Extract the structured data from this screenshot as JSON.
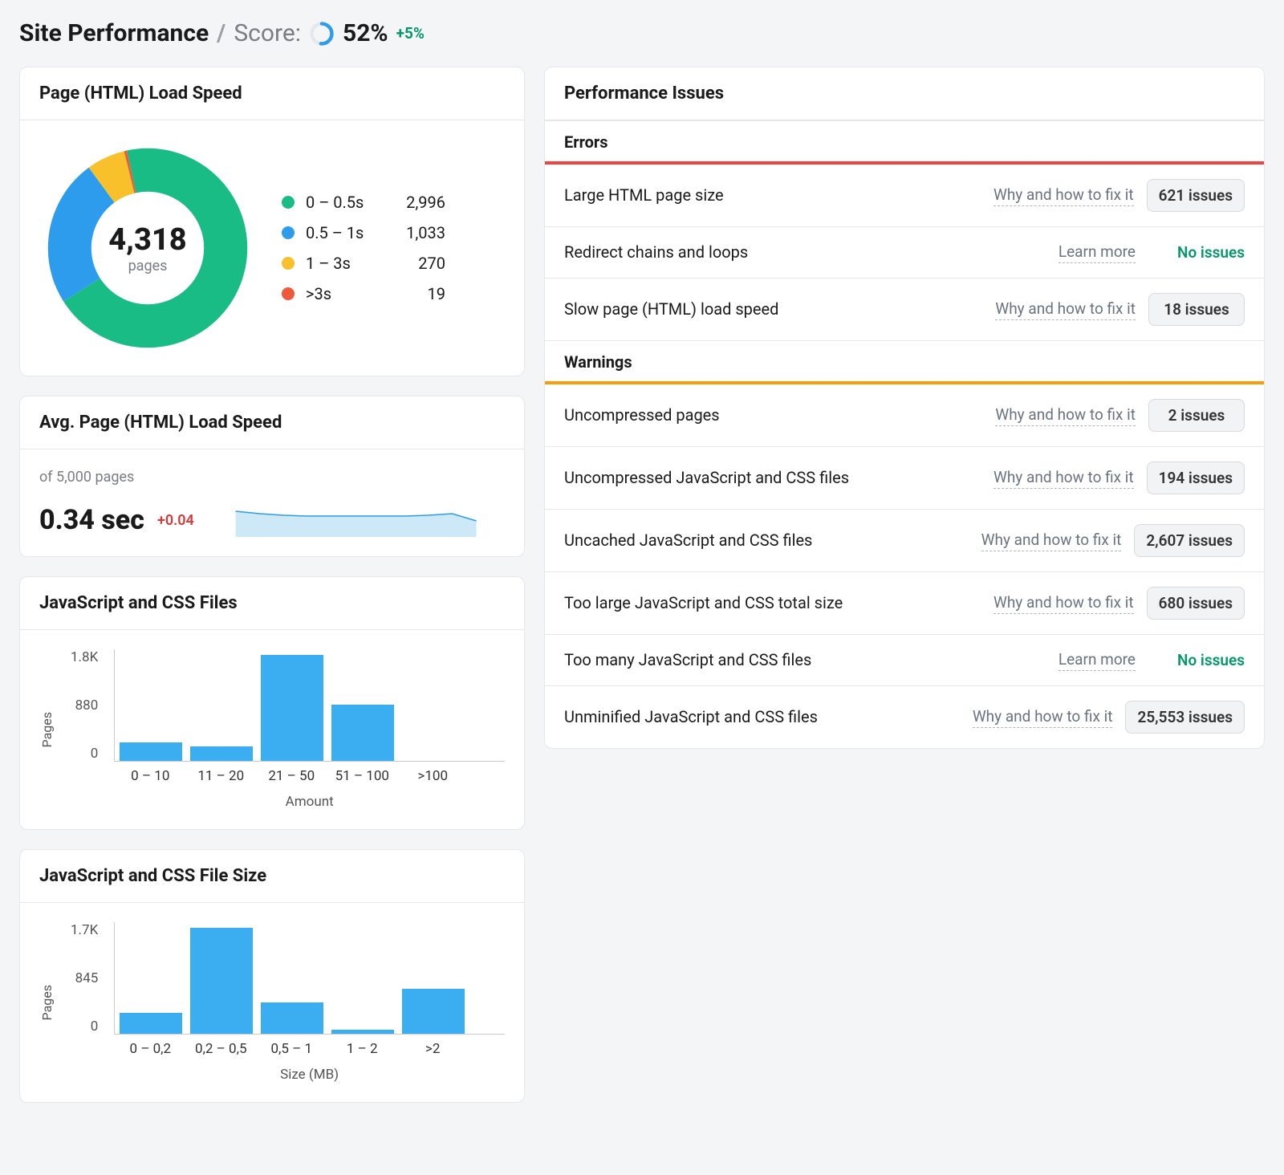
{
  "header": {
    "title": "Site Performance",
    "score_label": "Score:",
    "score_value": "52%",
    "score_delta": "+5%",
    "score_ring_pct": 52
  },
  "loadSpeed": {
    "title": "Page (HTML) Load Speed",
    "total_value": "4,318",
    "total_label": "pages",
    "legend": [
      {
        "label": "0 – 0.5s",
        "value": "2,996",
        "color": "#1abc85"
      },
      {
        "label": "0.5 – 1s",
        "value": "1,033",
        "color": "#2d9ced"
      },
      {
        "label": "1 – 3s",
        "value": "270",
        "color": "#f8c12b"
      },
      {
        "label": ">3s",
        "value": "19",
        "color": "#ed5b3a"
      }
    ]
  },
  "avgSpeed": {
    "title": "Avg. Page (HTML) Load Speed",
    "subtitle": "of 5,000 pages",
    "value": "0.34 sec",
    "delta": "+0.04"
  },
  "jsCssFiles": {
    "title": "JavaScript and CSS Files",
    "ylabel": "Pages",
    "xlabel": "Amount",
    "yticks": [
      "1.8K",
      "880",
      "0"
    ]
  },
  "jsCssSize": {
    "title": "JavaScript and CSS File Size",
    "ylabel": "Pages",
    "xlabel": "Size (MB)",
    "yticks": [
      "1.7K",
      "845",
      "0"
    ]
  },
  "issues": {
    "title": "Performance Issues",
    "errors_label": "Errors",
    "warnings_label": "Warnings",
    "fix_link": "Why and how to fix it",
    "learn_link": "Learn more",
    "no_issues": "No issues",
    "errors": [
      {
        "name": "Large HTML page size",
        "link": "fix",
        "count": "621 issues"
      },
      {
        "name": "Redirect chains and loops",
        "link": "learn",
        "count": null
      },
      {
        "name": "Slow page (HTML) load speed",
        "link": "fix",
        "count": "18 issues"
      }
    ],
    "warnings": [
      {
        "name": "Uncompressed pages",
        "link": "fix",
        "count": "2 issues"
      },
      {
        "name": "Uncompressed JavaScript and CSS files",
        "link": "fix",
        "count": "194 issues"
      },
      {
        "name": "Uncached JavaScript and CSS files",
        "link": "fix",
        "count": "2,607 issues"
      },
      {
        "name": "Too large JavaScript and CSS total size",
        "link": "fix",
        "count": "680 issues"
      },
      {
        "name": "Too many JavaScript and CSS files",
        "link": "learn",
        "count": null
      },
      {
        "name": "Unminified JavaScript and CSS files",
        "link": "fix",
        "count": "25,553 issues"
      }
    ]
  },
  "chart_data": [
    {
      "type": "pie",
      "title": "Page (HTML) Load Speed",
      "categories": [
        "0 – 0.5s",
        "0.5 – 1s",
        "1 – 3s",
        ">3s"
      ],
      "values": [
        2996,
        1033,
        270,
        19
      ],
      "total": 4318
    },
    {
      "type": "bar",
      "title": "JavaScript and CSS Files",
      "xlabel": "Amount",
      "ylabel": "Pages",
      "categories": [
        "0 – 10",
        "11 – 20",
        "21 – 50",
        "51 – 100",
        ">100"
      ],
      "values": [
        320,
        250,
        1800,
        950,
        0
      ],
      "ylim": [
        0,
        1800
      ]
    },
    {
      "type": "bar",
      "title": "JavaScript and CSS File Size",
      "xlabel": "Size (MB)",
      "ylabel": "Pages",
      "categories": [
        "0 – 0,2",
        "0,2 – 0,5",
        "0,5 – 1",
        "1 – 2",
        ">2"
      ],
      "values": [
        340,
        1700,
        500,
        60,
        720
      ],
      "ylim": [
        0,
        1700
      ]
    },
    {
      "type": "line",
      "title": "Avg. Page (HTML) Load Speed",
      "values": [
        0.36,
        0.35,
        0.345,
        0.34,
        0.34,
        0.34,
        0.34,
        0.34,
        0.345,
        0.35,
        0.32
      ],
      "ylim": [
        0.3,
        0.4
      ]
    }
  ]
}
